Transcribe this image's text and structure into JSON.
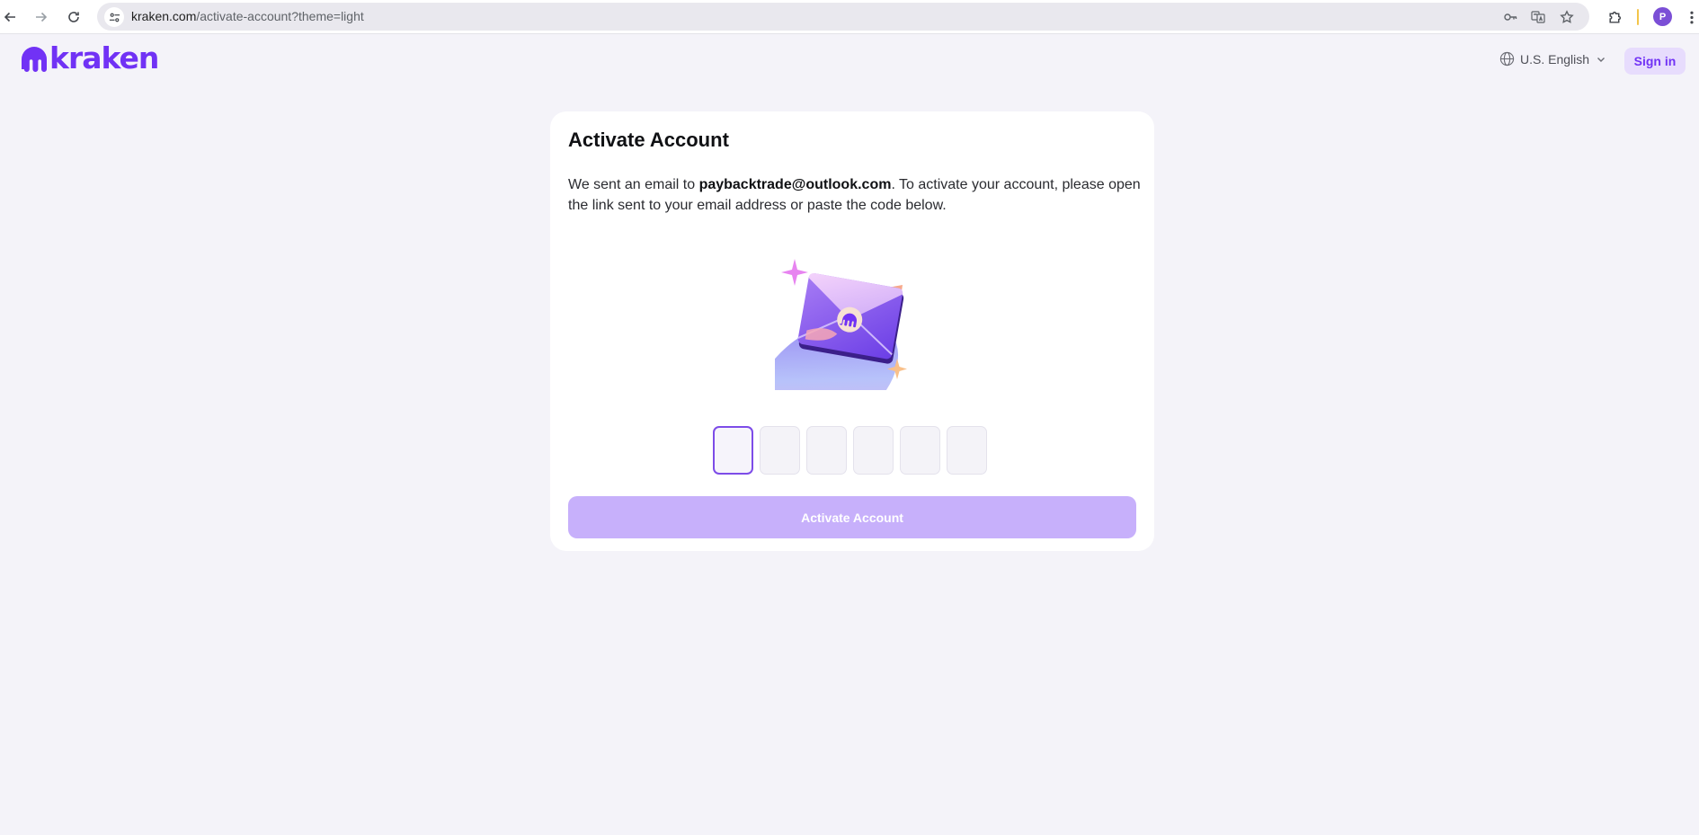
{
  "browser": {
    "url_host": "kraken.com",
    "url_path": "/activate-account?theme=light",
    "profile_initial": "P",
    "icons": [
      "back-arrow-icon",
      "forward-arrow-icon",
      "reload-icon",
      "site-info-icon",
      "password-key-icon",
      "translate-icon",
      "bookmark-star-icon",
      "extensions-icon",
      "more-menu-icon"
    ]
  },
  "header": {
    "logo_text": "kraken",
    "language": "U.S. English",
    "signin_label": "Sign in"
  },
  "card": {
    "title": "Activate Account",
    "message_prefix": "We sent an email to ",
    "email": "paybacktrade@outlook.com",
    "message_suffix": ". To activate your account, please open the link sent to your email address or paste the code below.",
    "code_digits": [
      "",
      "",
      "",
      "",
      "",
      ""
    ],
    "button_label": "Activate Account"
  },
  "colors": {
    "brand": "#7132f5",
    "page_bg": "#f4f3f9",
    "button_disabled": "#c7b0fb",
    "signin_bg": "#e7dcfd"
  }
}
